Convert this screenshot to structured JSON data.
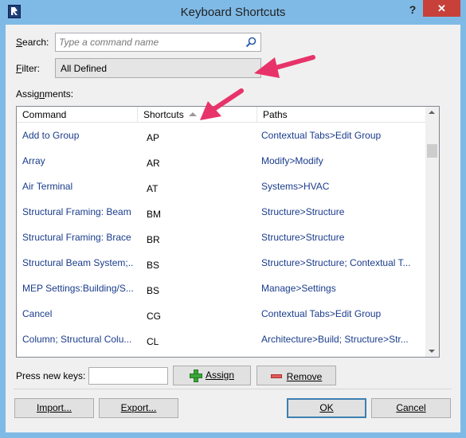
{
  "window": {
    "title": "Keyboard Shortcuts",
    "help_label": "?",
    "close_label": "✕"
  },
  "search": {
    "label": "Search:",
    "label_accel": "S",
    "label_rest": "earch:",
    "placeholder": "Type a command name",
    "icon": "search-icon"
  },
  "filter": {
    "label_accel": "F",
    "label_rest": "ilter:",
    "value": "All Defined"
  },
  "assignments": {
    "label_pre": "Assig",
    "label_accel": "n",
    "label_post": "ments:"
  },
  "grid": {
    "columns": [
      {
        "label": "Command"
      },
      {
        "label": "Shortcuts",
        "sort": "ascending"
      },
      {
        "label": "Paths"
      }
    ],
    "rows": [
      {
        "command": "Add to Group",
        "shortcut": "AP",
        "path": "Contextual Tabs>Edit Group"
      },
      {
        "command": "Array",
        "shortcut": "AR",
        "path": "Modify>Modify"
      },
      {
        "command": "Air Terminal",
        "shortcut": "AT",
        "path": "Systems>HVAC"
      },
      {
        "command": "Structural Framing: Beam",
        "shortcut": "BM",
        "path": "Structure>Structure"
      },
      {
        "command": "Structural Framing: Brace",
        "shortcut": "BR",
        "path": "Structure>Structure"
      },
      {
        "command": "Structural Beam System;...",
        "shortcut": "BS",
        "path": "Structure>Structure; Contextual T..."
      },
      {
        "command": "MEP Settings:Building/S...",
        "shortcut": "BS",
        "path": "Manage>Settings"
      },
      {
        "command": "Cancel",
        "shortcut": "CG",
        "path": "Contextual Tabs>Edit Group"
      },
      {
        "command": "Column; Structural Colu...",
        "shortcut": "CL",
        "path": "Architecture>Build; Structure>Str..."
      }
    ]
  },
  "new_keys": {
    "label": "Press new keys:",
    "value": ""
  },
  "buttons": {
    "assign": "Assign",
    "remove": "Remove",
    "import": "Import...",
    "export": "Export...",
    "ok": "OK",
    "cancel": "Cancel"
  },
  "colors": {
    "window_frame": "#7fbae6",
    "close_button": "#c7413a",
    "link_text": "#1a3c8c",
    "annotation_arrow": "#e8336a"
  }
}
